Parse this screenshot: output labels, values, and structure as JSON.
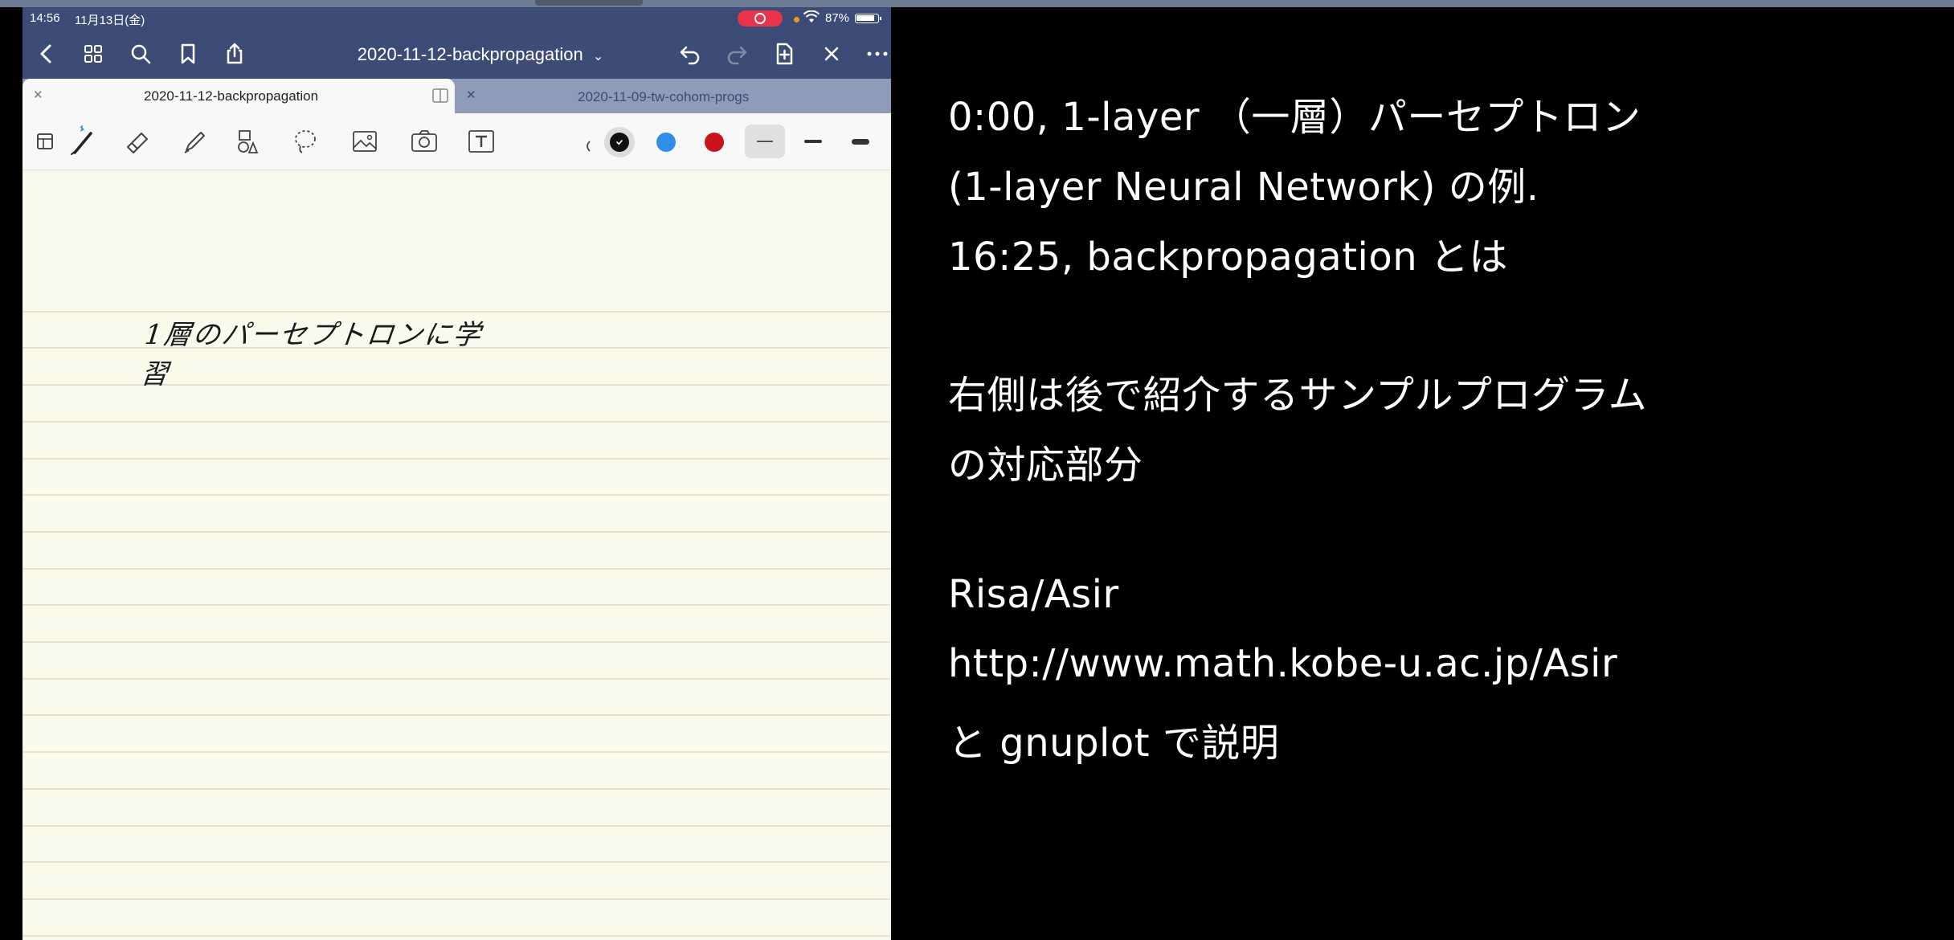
{
  "status_bar": {
    "time": "14:56",
    "date": "11月13日(金)",
    "battery": "87%"
  },
  "nav": {
    "document_title": "2020-11-12-backpropagation",
    "title_chevron": "⌄"
  },
  "tabs": [
    {
      "label": "2020-11-12-backpropagation",
      "active": true
    },
    {
      "label": "2020-11-09-tw-cohom-progs",
      "active": false
    }
  ],
  "toolbar": {
    "colors": [
      "#111111",
      "#2f8ee8",
      "#c9141e"
    ]
  },
  "note": {
    "handwriting": "1層のパーセプトロンに学習"
  },
  "slide": {
    "lines": [
      "0:00, 1-layer （一層）パーセプトロン",
      "(1-layer Neural Network) の例.",
      "16:25, backpropagation とは",
      "右側は後で紹介するサンプルプログラム",
      "の対応部分",
      "Risa/Asir",
      " http://www.math.kobe-u.ac.jp/Asir",
      "と gnuplot で説明"
    ]
  }
}
